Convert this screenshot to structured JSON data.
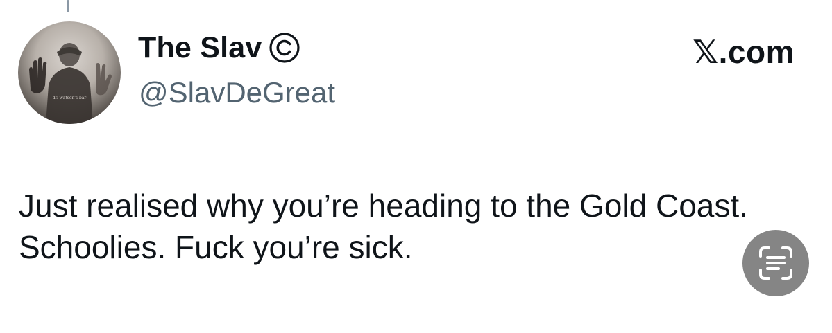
{
  "tweet": {
    "display_name": "The Slav",
    "handle": "@SlavDeGreat",
    "brand": "𝕏.com",
    "text": "Just realised why you’re heading to the Gold Coast. Schoolies. Fuck you’re sick.",
    "avatar_caption": "dr. watson's bar"
  },
  "icons": {
    "verified": "copyright-icon",
    "live_text": "text-scan-icon"
  }
}
